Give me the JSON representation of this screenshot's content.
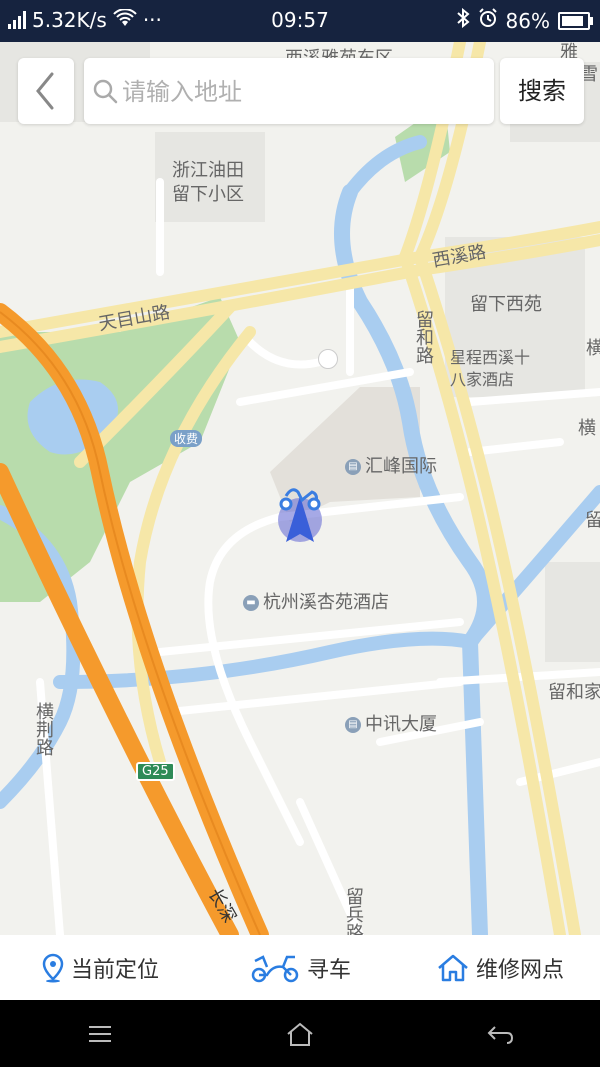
{
  "status_bar": {
    "speed": "5.32K/s",
    "more": "···",
    "time": "09:57",
    "battery": "86%",
    "battery_level": 0.86
  },
  "search": {
    "placeholder": "请输入地址",
    "button_label": "搜索"
  },
  "map_labels": {
    "top_area": "西溪雅苑东区",
    "top_right": "雅",
    "top_right2": "雪",
    "oil_area_line1": "浙江油田",
    "oil_area_line2": "留下小区",
    "road_xixi": "西溪路",
    "road_tianmushan": "天目山路",
    "area_liuxia_xiyuan": "留下西苑",
    "road_liuhe": "留和路",
    "hotel_line1": "星程西溪十",
    "hotel_line2": "八家酒店",
    "toll": "收费",
    "huifeng": "汇峰国际",
    "xixingyuan": "杭州溪杏苑酒店",
    "zhongxun": "中讯大厦",
    "liuhejia": "留和家",
    "road_hengjing": "横荆路",
    "highway_badge": "G25",
    "road_changshen": "长深",
    "road_liubing": "留兵路",
    "right_heng1": "横",
    "right_heng2": "横",
    "right_liu": "留"
  },
  "bottom_tabs": [
    {
      "label": "当前定位",
      "icon": "location-pin-icon"
    },
    {
      "label": "寻车",
      "icon": "scooter-icon"
    },
    {
      "label": "维修网点",
      "icon": "home-icon"
    }
  ],
  "colors": {
    "accent": "#2a7de1",
    "map_background": "#f2f2ee",
    "water": "#a9cdf0",
    "park": "#b8dcac",
    "highway": "#f59a2c",
    "arterial": "#f6e7a8"
  }
}
